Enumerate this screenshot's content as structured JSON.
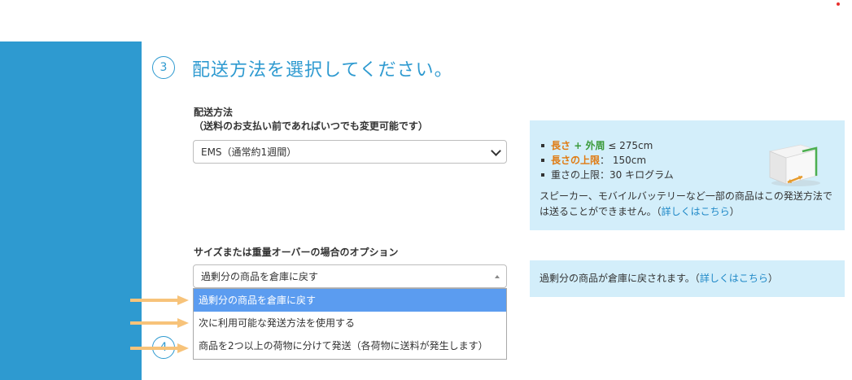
{
  "step3": {
    "number": "3",
    "title": "配送方法を選択してください。"
  },
  "step4": {
    "number": "4"
  },
  "shipping": {
    "label_line1": "配送方法",
    "label_line2": "（送料のお支払い前であればいつでも変更可能です）",
    "selected": "EMS（通常約1週間）"
  },
  "info_shipping": {
    "item1_length": "長さ",
    "item1_plus": " + ",
    "item1_girth": "外周",
    "item1_value": " ≤ 275cm",
    "item2_label": "長さの上限",
    "item2_value": "： 150cm",
    "item3_text": "重さの上限：30 キログラム",
    "desc": "スピーカー、モバイルバッテリーなど一部の商品はこの発送方法では送ることができません。（",
    "link": "詳しくはこちら",
    "desc_end": "）"
  },
  "overweight": {
    "label": "サイズまたは重量オーバーの場合のオプション",
    "selected": "過剰分の商品を倉庫に戻す",
    "options": [
      "過剰分の商品を倉庫に戻す",
      "次に利用可能な発送方法を使用する",
      "商品を2つ以上の荷物に分けて発送（各荷物に送料が発生します）"
    ]
  },
  "info_overweight": {
    "text": "過剰分の商品が倉庫に戻されます。（",
    "link": "詳しくはこちら",
    "text_end": "）"
  },
  "colors": {
    "sidebar": "#2e9ad0",
    "info_bg": "#d3eefa",
    "selected_option": "#5b9cf0",
    "arrow": "#f7c37a"
  }
}
